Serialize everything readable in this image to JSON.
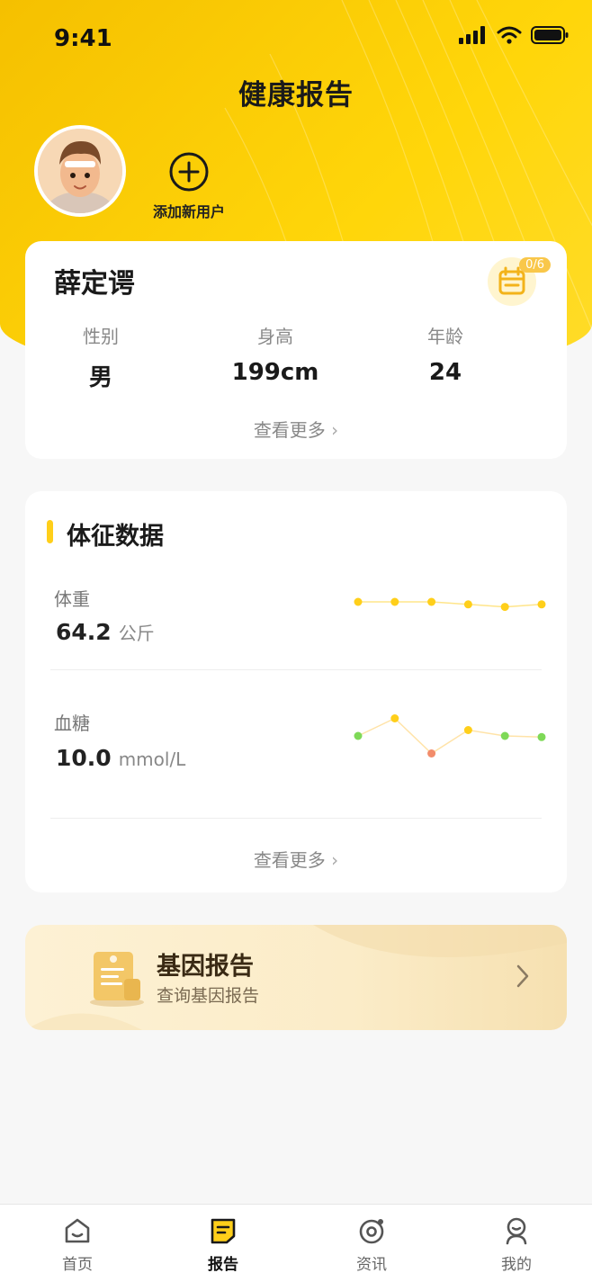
{
  "status_bar": {
    "time": "9:41"
  },
  "header": {
    "title": "健康报告",
    "add_user_label": "添加新用户"
  },
  "user_card": {
    "name": "薛定谔",
    "calendar_count": "0/6",
    "stats": [
      {
        "label": "性别",
        "value": "男"
      },
      {
        "label": "身高",
        "value": "199cm"
      },
      {
        "label": "年龄",
        "value": "24"
      }
    ],
    "more": "查看更多"
  },
  "vitals_card": {
    "title": "体征数据",
    "weight": {
      "label": "体重",
      "value": "64.2",
      "unit": "公斤",
      "trend": [
        3,
        3,
        3,
        2.6,
        2.2,
        2.6
      ]
    },
    "glucose": {
      "label": "血糖",
      "value": "10.0",
      "unit": "mmol/L",
      "trend": [
        4,
        7,
        1,
        5,
        4,
        3.8
      ],
      "point_colors": [
        "#7ed957",
        "#ffcf1a",
        "#f28c6b",
        "#ffcf1a",
        "#7ed957",
        "#7ed957"
      ]
    },
    "more": "查看更多"
  },
  "gene_card": {
    "title": "基因报告",
    "subtitle": "查询基因报告"
  },
  "tabbar": {
    "items": [
      {
        "label": "首页",
        "icon": "home-icon",
        "active": false
      },
      {
        "label": "报告",
        "icon": "report-icon",
        "active": true
      },
      {
        "label": "资讯",
        "icon": "news-icon",
        "active": false
      },
      {
        "label": "我的",
        "icon": "profile-icon",
        "active": false
      }
    ]
  },
  "colors": {
    "accent": "#ffcf1a",
    "header_gradient_start": "#f5c000",
    "gene_card_bg": "#fbecc8"
  }
}
